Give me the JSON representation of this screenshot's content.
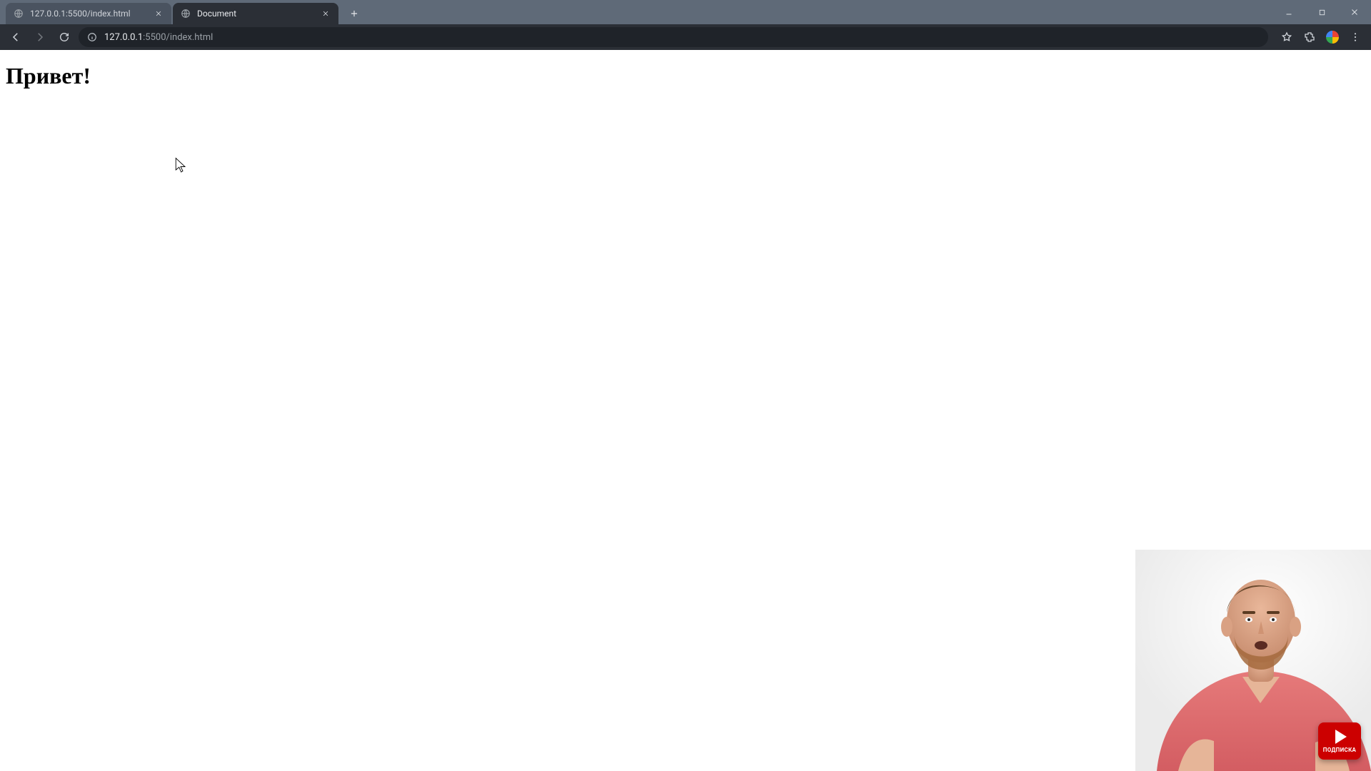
{
  "window": {
    "minimize": "—",
    "maximize": "▢",
    "close": "✕"
  },
  "tabs": [
    {
      "title": "127.0.0.1:5500/index.html",
      "active": false
    },
    {
      "title": "Document",
      "active": true
    }
  ],
  "new_tab_tooltip": "New tab",
  "address_bar": {
    "url_host": "127.0.0.1",
    "url_port_path": ":5500/index.html"
  },
  "page": {
    "heading": "Привет!"
  },
  "overlay": {
    "subscribe_label": "ПОДПИСКА"
  }
}
